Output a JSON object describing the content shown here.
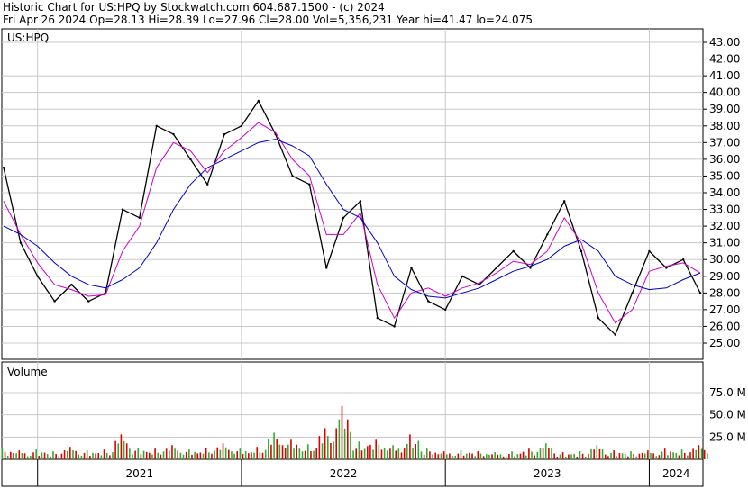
{
  "header": {
    "line1": "Historic Chart for US:HPQ by Stockwatch.com 604.687.1500 - (c) 2024",
    "line2": "Fri Apr 26 2024   Op=28.13   Hi=28.39   Lo=27.96   Cl=28.00   Vol=5,356,231   Year hi=41.47   lo=24.075"
  },
  "colors": {
    "price": "#000000",
    "ma_short": "#cc00cc",
    "ma_long": "#0000cc",
    "vol_up": "#33aa33",
    "vol_down": "#dd0000",
    "grid": "#c8c8c8"
  },
  "chart_data": [
    {
      "type": "line",
      "title": "US:HPQ",
      "ylim": [
        24.075,
        43.5
      ],
      "y_ticks": [
        "43.00",
        "42.00",
        "41.00",
        "40.00",
        "39.00",
        "38.00",
        "37.00",
        "36.00",
        "35.00",
        "34.00",
        "33.00",
        "32.00",
        "31.00",
        "30.00",
        "29.00",
        "28.00",
        "27.00",
        "26.00",
        "25.00"
      ],
      "x_ticks": [
        "2021",
        "2022",
        "2023",
        "2024"
      ],
      "x": [
        "2020-11",
        "2020-12",
        "2021-01",
        "2021-02",
        "2021-03",
        "2021-04",
        "2021-05",
        "2021-06",
        "2021-07",
        "2021-08",
        "2021-09",
        "2021-10",
        "2021-11",
        "2021-12",
        "2022-01",
        "2022-02",
        "2022-03",
        "2022-04",
        "2022-05",
        "2022-06",
        "2022-07",
        "2022-08",
        "2022-09",
        "2022-10",
        "2022-11",
        "2022-12",
        "2023-01",
        "2023-02",
        "2023-03",
        "2023-04",
        "2023-05",
        "2023-06",
        "2023-07",
        "2023-08",
        "2023-09",
        "2023-10",
        "2023-11",
        "2023-12",
        "2024-01",
        "2024-02",
        "2024-03",
        "2024-04"
      ],
      "series": [
        {
          "name": "",
          "values": [
            35.5,
            31.0,
            29.0,
            27.5,
            28.5,
            27.5,
            28.0,
            33.0,
            32.5,
            38.0,
            37.5,
            36.0,
            34.5,
            37.5,
            38.0,
            39.5,
            37.5,
            35.0,
            34.5,
            29.5,
            32.5,
            33.5,
            26.5,
            26.0,
            29.5,
            27.5,
            27.0,
            29.0,
            28.5,
            29.5,
            30.5,
            29.5,
            31.5,
            33.5,
            30.5,
            26.5,
            25.5,
            28.0,
            30.5,
            29.5,
            30.0,
            28.0
          ]
        },
        {
          "name": "",
          "values": [
            33.5,
            31.5,
            29.8,
            28.5,
            28.2,
            27.8,
            27.9,
            30.5,
            32.0,
            35.5,
            37.0,
            36.5,
            35.2,
            36.5,
            37.3,
            38.2,
            37.6,
            36.0,
            35.0,
            31.5,
            31.5,
            32.8,
            28.5,
            26.5,
            28.0,
            28.3,
            27.8,
            28.3,
            28.6,
            29.2,
            29.9,
            29.7,
            30.5,
            32.5,
            31.0,
            28.0,
            26.2,
            27.0,
            29.3,
            29.6,
            29.8,
            29.2
          ]
        },
        {
          "name": "",
          "values": [
            32.0,
            31.5,
            30.8,
            29.8,
            29.0,
            28.5,
            28.3,
            28.8,
            29.5,
            31.0,
            33.0,
            34.5,
            35.5,
            36.0,
            36.5,
            37.0,
            37.2,
            36.8,
            36.2,
            34.5,
            33.0,
            32.5,
            31.0,
            29.0,
            28.2,
            27.8,
            27.7,
            28.0,
            28.3,
            28.8,
            29.3,
            29.6,
            30.0,
            30.8,
            31.2,
            30.5,
            29.0,
            28.5,
            28.2,
            28.3,
            28.8,
            29.2
          ]
        }
      ]
    },
    {
      "type": "bar",
      "title": "Volume",
      "ylim": [
        0,
        90
      ],
      "y_ticks": [
        "75.0 M",
        "50.0 M",
        "25.0 M"
      ],
      "categories": [
        "2020-11",
        "2020-12",
        "2021-01",
        "2021-02",
        "2021-03",
        "2021-04",
        "2021-05",
        "2021-06",
        "2021-07",
        "2021-08",
        "2021-09",
        "2021-10",
        "2021-11",
        "2021-12",
        "2022-01",
        "2022-02",
        "2022-03",
        "2022-04",
        "2022-05",
        "2022-06",
        "2022-07",
        "2022-08",
        "2022-09",
        "2022-10",
        "2022-11",
        "2022-12",
        "2023-01",
        "2023-02",
        "2023-03",
        "2023-04",
        "2023-05",
        "2023-06",
        "2023-07",
        "2023-08",
        "2023-09",
        "2023-10",
        "2023-11",
        "2023-12",
        "2024-01",
        "2024-02",
        "2024-03",
        "2024-04"
      ],
      "values": [
        12,
        10,
        11,
        9,
        14,
        10,
        11,
        28,
        13,
        12,
        16,
        11,
        13,
        18,
        12,
        14,
        30,
        22,
        17,
        35,
        60,
        20,
        22,
        16,
        28,
        12,
        9,
        10,
        9,
        8,
        9,
        12,
        18,
        8,
        9,
        16,
        10,
        9,
        10,
        12,
        11,
        16
      ],
      "up": [
        0,
        1,
        0,
        0,
        1,
        0,
        1,
        1,
        0,
        1,
        1,
        0,
        1,
        1,
        0,
        1,
        0,
        1,
        0,
        1,
        1,
        0,
        1,
        0,
        1,
        0,
        1,
        0,
        1,
        0,
        0,
        1,
        0,
        1,
        0,
        0,
        1,
        0,
        1,
        1,
        0,
        1
      ]
    }
  ]
}
